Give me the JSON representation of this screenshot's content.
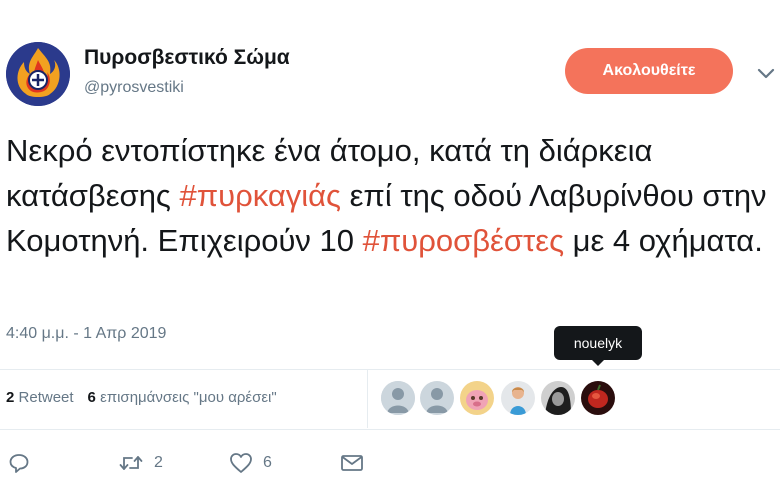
{
  "header": {
    "display_name": "Πυροσβεστικό Σώμα",
    "handle": "@pyrosvestiki",
    "follow_label": "Ακολουθείτε"
  },
  "tweet": {
    "parts": [
      {
        "text": "Νεκρό εντοπίστηκε ένα άτομο, κατά τη διάρκεια κατάσβεσης ",
        "hashtag": false
      },
      {
        "text": "#πυρκαγιάς",
        "hashtag": true
      },
      {
        "text": " επί της οδού Λαβυρίνθου στην Κομοτηνή. Επιχειρούν 10 ",
        "hashtag": false
      },
      {
        "text": "#πυροσβέστες",
        "hashtag": true
      },
      {
        "text": " με 4 οχήματα.",
        "hashtag": false
      }
    ],
    "timestamp": "4:40 μ.μ. - 1 Απρ 2019"
  },
  "tooltip": {
    "text": "nouelyk"
  },
  "stats": {
    "retweet_count": "2",
    "retweet_label": "Retweet",
    "likes_count": "6",
    "likes_label": "επισημάνσεις \"μου αρέσει\""
  },
  "likers": [
    {
      "icon": "default-avatar-icon"
    },
    {
      "icon": "default-avatar-icon"
    },
    {
      "icon": "user-photo-icon"
    },
    {
      "icon": "user-photo-icon"
    },
    {
      "icon": "user-photo-icon"
    },
    {
      "icon": "user-photo-icon"
    }
  ],
  "actions": {
    "reply_icon": "reply-icon",
    "retweet_count": "2",
    "like_count": "6",
    "dm_icon": "envelope-icon"
  },
  "colors": {
    "accent": "#f4735b",
    "hashtag": "#e0533a",
    "muted": "#657786",
    "text": "#14171a"
  }
}
